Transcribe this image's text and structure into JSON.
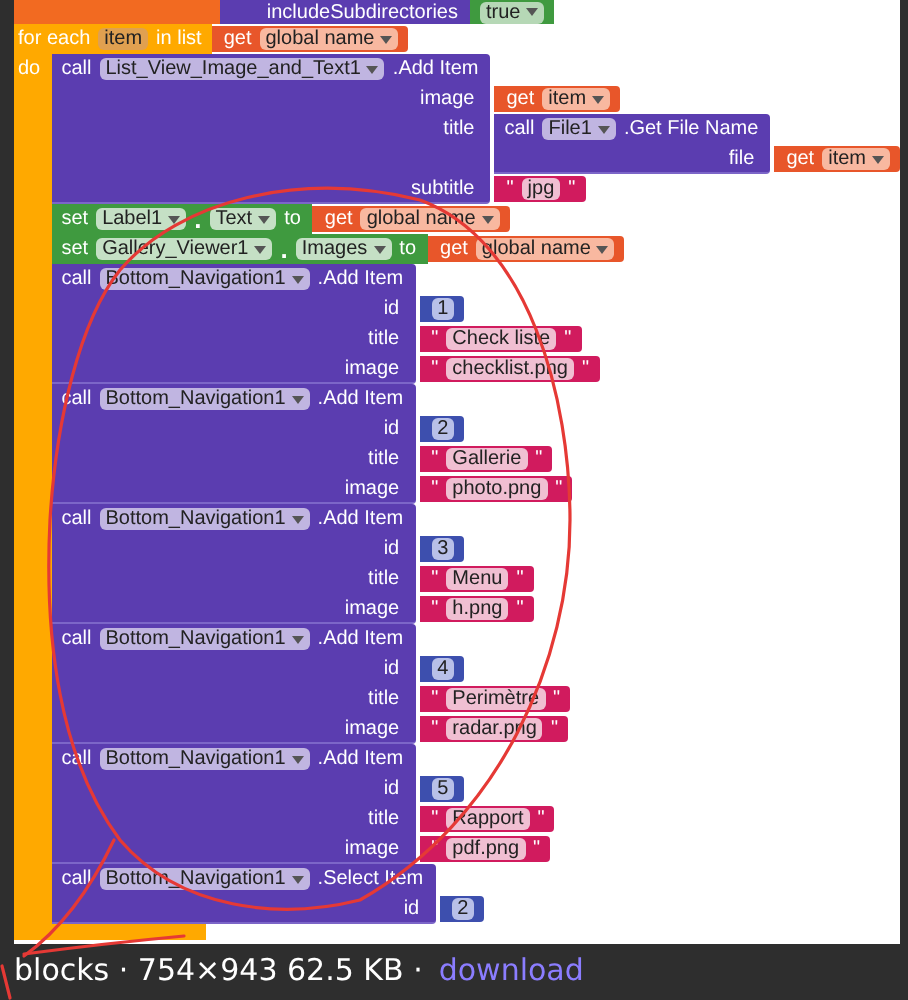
{
  "top_block": {
    "label": "includeSubdirectories",
    "value": "true"
  },
  "for_each": {
    "keyword": "for each",
    "variable": "item",
    "in_list": "in list",
    "list": {
      "kind": "get",
      "keyword": "get",
      "name": "global name"
    },
    "do": "do",
    "statements": [
      {
        "kind": "call",
        "keyword": "call",
        "component": "List_View_Image_and_Text1",
        "method": ".Add Item",
        "args": [
          {
            "name": "image",
            "value": {
              "kind": "get",
              "keyword": "get",
              "name": "item"
            }
          },
          {
            "name": "title",
            "value": {
              "kind": "call",
              "keyword": "call",
              "component": "File1",
              "method": ".Get File Name",
              "args": [
                {
                  "name": "file",
                  "value": {
                    "kind": "get",
                    "keyword": "get",
                    "name": "item"
                  }
                }
              ]
            }
          },
          {
            "name": "subtitle",
            "value": {
              "kind": "text",
              "text": "jpg"
            }
          }
        ]
      },
      {
        "kind": "set",
        "keyword": "set",
        "component": "Label1",
        "separator": ".",
        "property": "Text",
        "to": "to",
        "value": {
          "kind": "get",
          "keyword": "get",
          "name": "global name"
        }
      },
      {
        "kind": "set",
        "keyword": "set",
        "component": "Gallery_Viewer1",
        "separator": ".",
        "property": "Images",
        "to": "to",
        "value": {
          "kind": "get",
          "keyword": "get",
          "name": "global name"
        }
      },
      {
        "kind": "call",
        "keyword": "call",
        "component": "Bottom_Navigation1",
        "method": ".Add Item",
        "args": [
          {
            "name": "id",
            "value": {
              "kind": "number",
              "text": "1"
            }
          },
          {
            "name": "title",
            "value": {
              "kind": "text",
              "text": "Check liste"
            }
          },
          {
            "name": "image",
            "value": {
              "kind": "text",
              "text": "checklist.png"
            }
          }
        ]
      },
      {
        "kind": "call",
        "keyword": "call",
        "component": "Bottom_Navigation1",
        "method": ".Add Item",
        "args": [
          {
            "name": "id",
            "value": {
              "kind": "number",
              "text": "2"
            }
          },
          {
            "name": "title",
            "value": {
              "kind": "text",
              "text": "Gallerie"
            }
          },
          {
            "name": "image",
            "value": {
              "kind": "text",
              "text": "photo.png"
            }
          }
        ]
      },
      {
        "kind": "call",
        "keyword": "call",
        "component": "Bottom_Navigation1",
        "method": ".Add Item",
        "args": [
          {
            "name": "id",
            "value": {
              "kind": "number",
              "text": "3"
            }
          },
          {
            "name": "title",
            "value": {
              "kind": "text",
              "text": "Menu"
            }
          },
          {
            "name": "image",
            "value": {
              "kind": "text",
              "text": "h.png"
            }
          }
        ]
      },
      {
        "kind": "call",
        "keyword": "call",
        "component": "Bottom_Navigation1",
        "method": ".Add Item",
        "args": [
          {
            "name": "id",
            "value": {
              "kind": "number",
              "text": "4"
            }
          },
          {
            "name": "title",
            "value": {
              "kind": "text",
              "text": "Perimètre"
            }
          },
          {
            "name": "image",
            "value": {
              "kind": "text",
              "text": "radar.png"
            }
          }
        ]
      },
      {
        "kind": "call",
        "keyword": "call",
        "component": "Bottom_Navigation1",
        "method": ".Add Item",
        "args": [
          {
            "name": "id",
            "value": {
              "kind": "number",
              "text": "5"
            }
          },
          {
            "name": "title",
            "value": {
              "kind": "text",
              "text": "Rapport"
            }
          },
          {
            "name": "image",
            "value": {
              "kind": "text",
              "text": "pdf.png"
            }
          }
        ]
      },
      {
        "kind": "call",
        "keyword": "call",
        "component": "Bottom_Navigation1",
        "method": ".Select Item",
        "args": [
          {
            "name": "id",
            "value": {
              "kind": "number",
              "text": "2"
            }
          }
        ]
      }
    ]
  },
  "quote": "\"",
  "caption": {
    "text": "blocks · 754×943 62.5 KB ·",
    "link": "download"
  }
}
